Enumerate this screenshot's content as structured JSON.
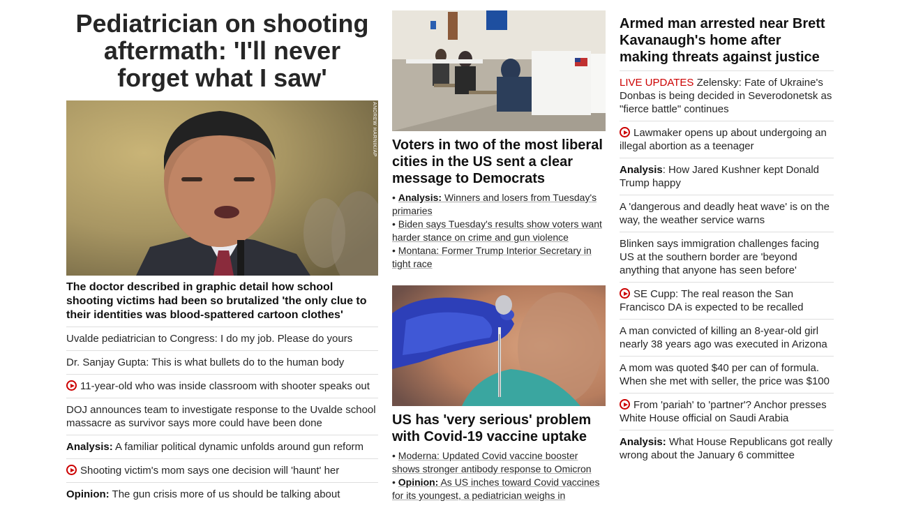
{
  "col1": {
    "hero_title": "Pediatrician on shooting aftermath: 'I'll never forget what I saw'",
    "photo_credit": "ANDREW HARNIK/AP",
    "hero_subtitle": "The doctor described in graphic detail how school shooting victims had been so brutalized 'the only clue to their identities was blood-spattered cartoon clothes'",
    "items": [
      {
        "prefix": "",
        "text": "Uvalde pediatrician to Congress: I do my job. Please do yours"
      },
      {
        "prefix": "",
        "text": "Dr. Sanjay Gupta: This is what bullets do to the human body"
      },
      {
        "prefix": "",
        "text": "11-year-old who was inside classroom with shooter speaks out"
      },
      {
        "prefix": "",
        "text": "DOJ announces team to investigate response to the Uvalde school massacre as survivor says more could have been done"
      },
      {
        "prefix": "Analysis:",
        "text": " A familiar political dynamic unfolds around gun reform"
      },
      {
        "prefix": "",
        "text": "Shooting victim's mom says one decision will 'haunt' her"
      },
      {
        "prefix": "Opinion:",
        "text": " The gun crisis more of us should be talking about"
      }
    ]
  },
  "col2": {
    "story1": {
      "title": "Voters in two of the most liberal cities in the US sent a clear message to Democrats",
      "bullets": [
        {
          "prefix": "Analysis:",
          "text": "Winners and losers from Tuesday's primaries"
        },
        {
          "prefix": "",
          "text": "Biden says Tuesday's results show voters want harder stance on crime and gun violence"
        },
        {
          "prefix": "",
          "text": "Montana: Former Trump Interior Secretary in tight race"
        }
      ]
    },
    "story2": {
      "title": "US has 'very serious' problem with Covid-19 vaccine uptake",
      "bullets": [
        {
          "prefix": "",
          "text": "Moderna: Updated Covid vaccine booster shows stronger antibody response to Omicron"
        },
        {
          "prefix": "Opinion:",
          "text": "As US inches toward Covid vaccines for its youngest, a pediatrician weighs in"
        }
      ]
    }
  },
  "col3": {
    "title": "Armed man arrested near Brett Kavanaugh's home after making threats against justice",
    "items": [
      {
        "live": "LIVE UPDATES",
        "prefix": "",
        "text": " Zelensky: Fate of Ukraine's Donbas is being decided in Severodonetsk as \"fierce battle\" continues"
      },
      {
        "live": "",
        "prefix": "",
        "text": "Lawmaker opens up about undergoing an illegal abortion as a teenager"
      },
      {
        "live": "",
        "prefix": "Analysis",
        "text": ": How Jared Kushner kept Donald Trump happy"
      },
      {
        "live": "",
        "prefix": "",
        "text": "A 'dangerous and deadly heat wave' is on the way, the weather service warns"
      },
      {
        "live": "",
        "prefix": "",
        "text": "Blinken says immigration challenges facing US at the southern border are 'beyond anything that anyone has seen before'"
      },
      {
        "live": "",
        "prefix": "",
        "text": "SE Cupp: The real reason the San Francisco DA is expected to be recalled"
      },
      {
        "live": "",
        "prefix": "",
        "text": "A man convicted of killing an 8-year-old girl nearly 38 years ago was executed in Arizona"
      },
      {
        "live": "",
        "prefix": "",
        "text": "A mom was quoted $40 per can of formula. When she met with seller, the price was $100"
      },
      {
        "live": "",
        "prefix": "",
        "text": "From 'pariah' to 'partner'? Anchor presses White House official on Saudi Arabia"
      },
      {
        "live": "",
        "prefix": "Analysis:",
        "text": " What House Republicans got really wrong about the January 6 committee"
      }
    ]
  }
}
